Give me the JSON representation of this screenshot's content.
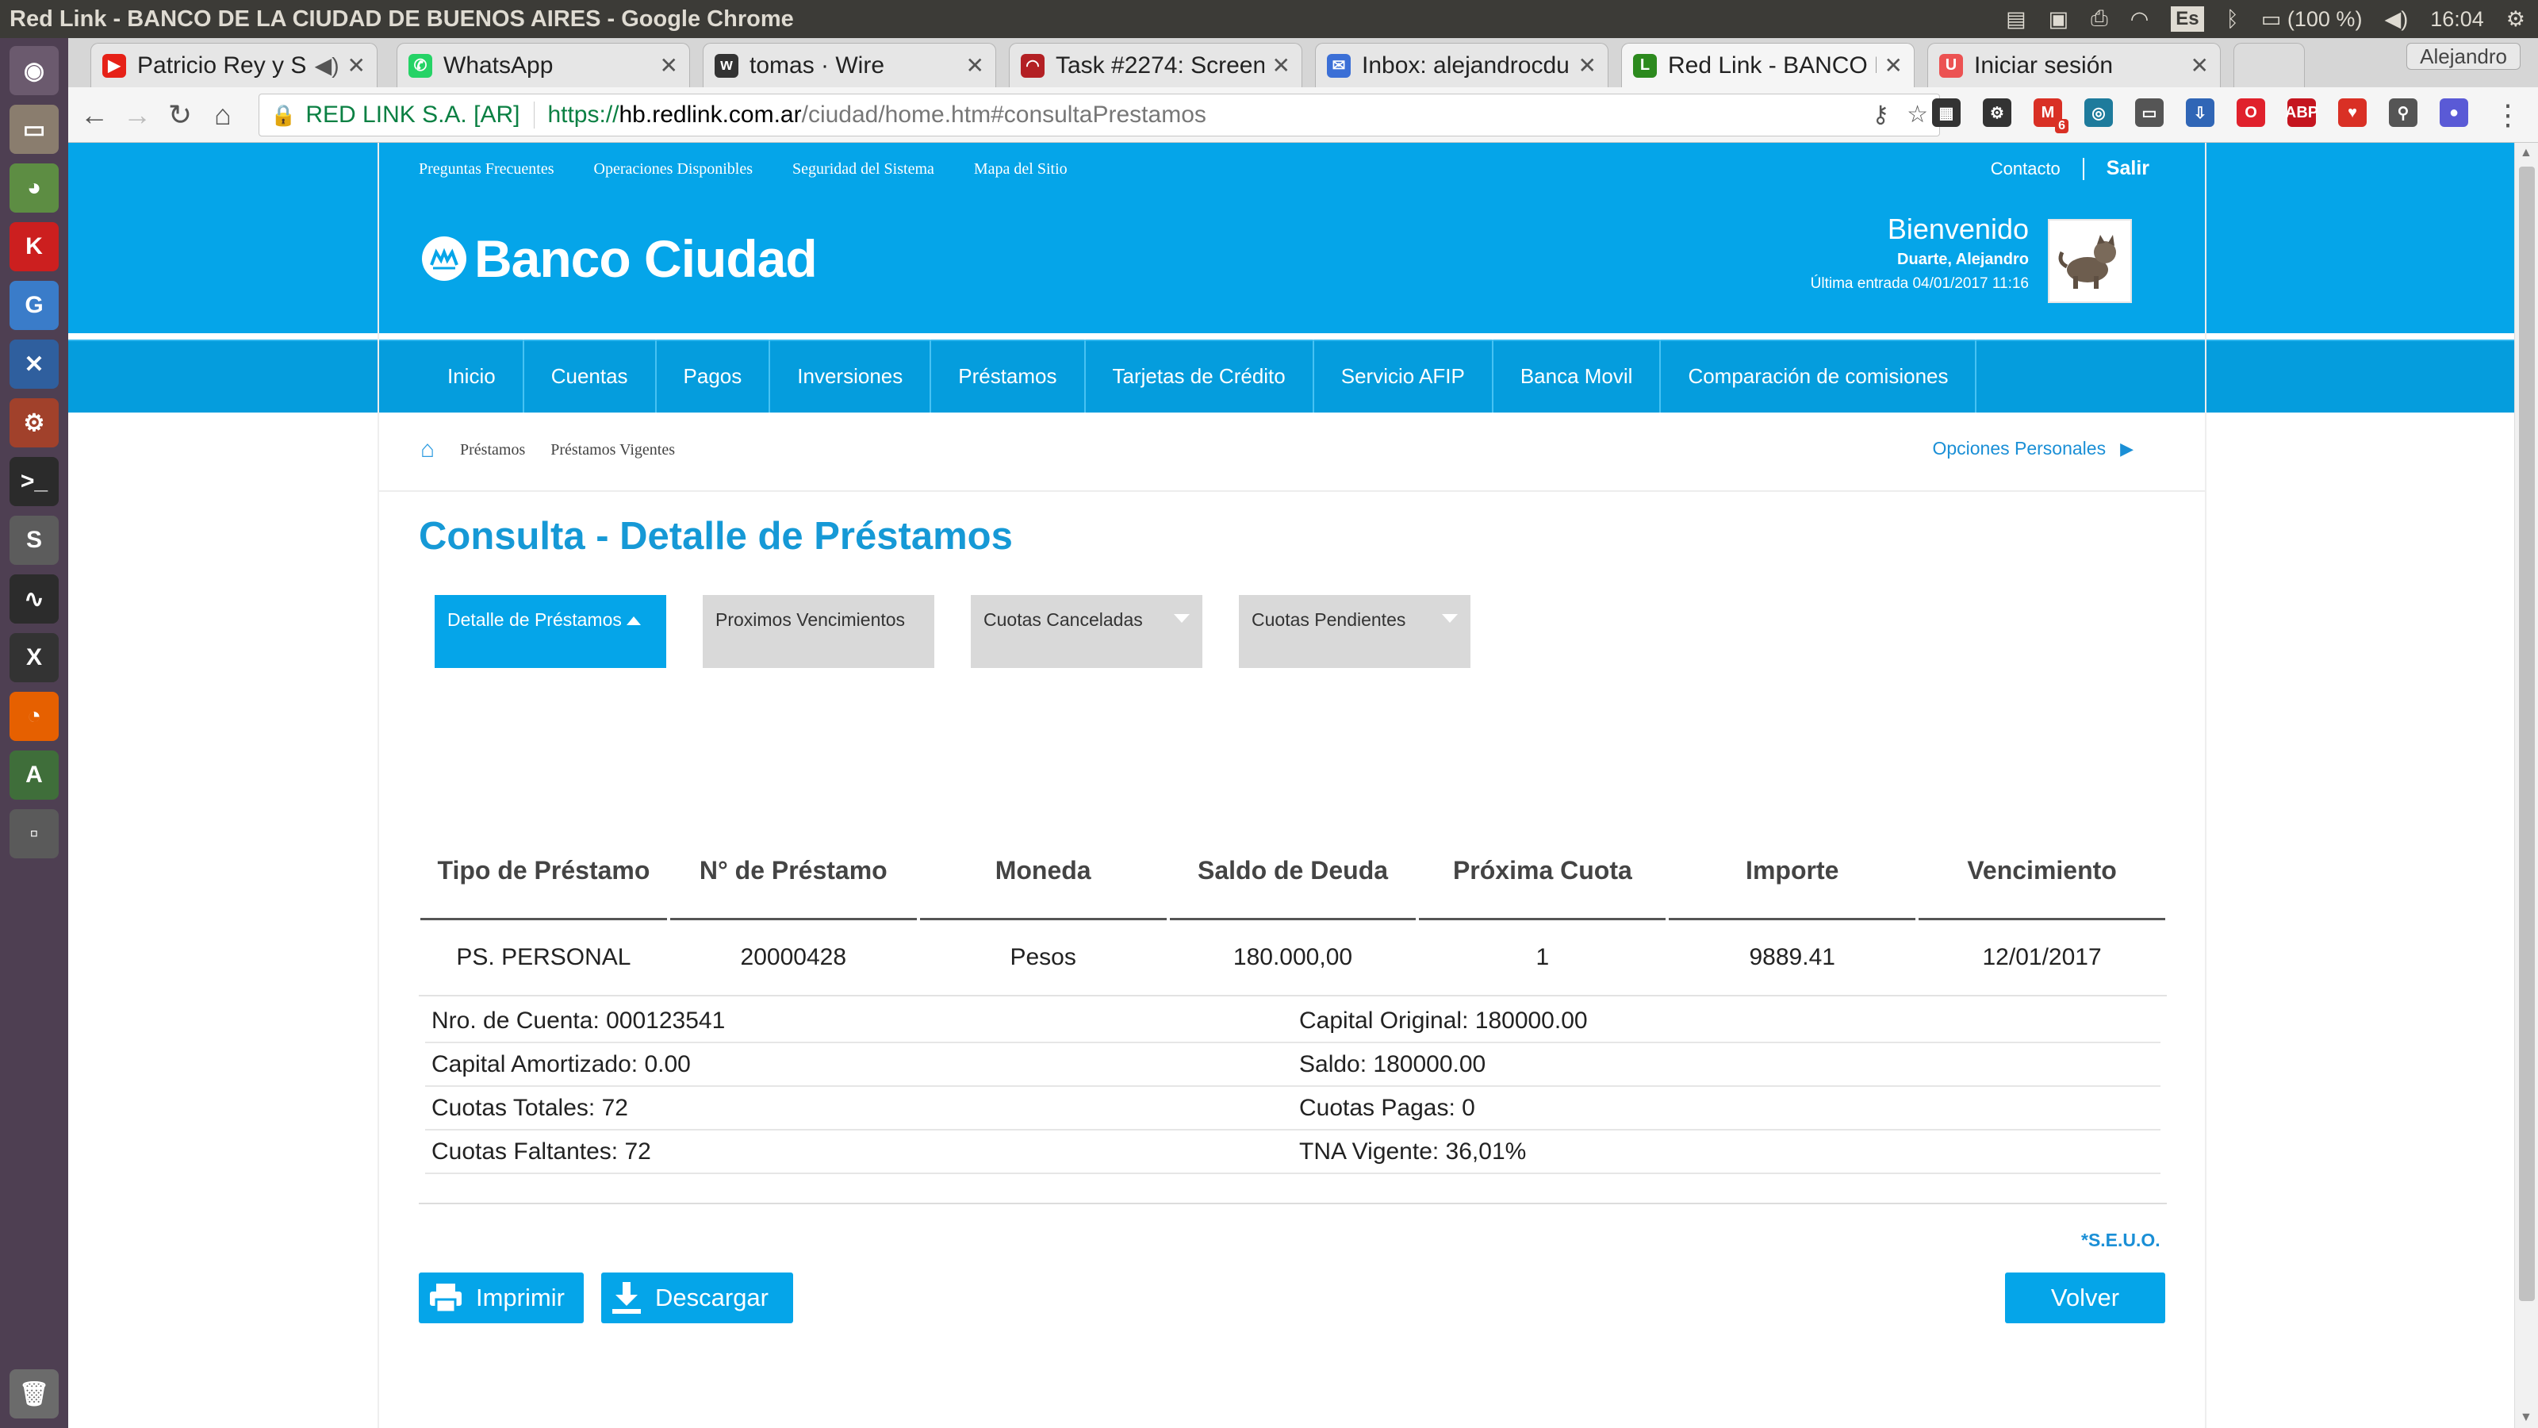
{
  "os": {
    "window_title": "Red Link - BANCO DE LA CIUDAD DE BUENOS AIRES - Google Chrome",
    "keyboard": "Es",
    "battery": "(100 %)",
    "time": "16:04"
  },
  "browser": {
    "tabs": [
      {
        "label": "Patricio Rey y Su",
        "favicon": "youtube-icon",
        "color": "#e62117"
      },
      {
        "label": "WhatsApp",
        "favicon": "whatsapp-icon",
        "color": "#25d366"
      },
      {
        "label": "tomas · Wire",
        "favicon": "wire-icon",
        "color": "#333333"
      },
      {
        "label": "Task #2274: Screen",
        "favicon": "redmine-icon",
        "color": "#b32024"
      },
      {
        "label": "Inbox: alejandrocdu",
        "favicon": "mail-icon",
        "color": "#3b6fd6"
      },
      {
        "label": "Red Link - BANCO D",
        "favicon": "redlink-icon",
        "color": "#2c8a1e"
      },
      {
        "label": "Iniciar sesión",
        "favicon": "udemy-icon",
        "color": "#ec5252"
      }
    ],
    "profile": "Alejandro",
    "address": {
      "secure_label": "RED LINK S.A. [AR]",
      "scheme": "https://",
      "host": "hb.redlink.com.ar",
      "path": "/ciudad/home.htm#consultaPrestamos"
    },
    "extensions": [
      {
        "name": "qr-icon",
        "glyph": "▦",
        "color": "#333333"
      },
      {
        "name": "gear-ext-icon",
        "glyph": "⚙",
        "color": "#333333"
      },
      {
        "name": "gmail-icon",
        "glyph": "M",
        "color": "#d93025",
        "badge": "6"
      },
      {
        "name": "wave-icon",
        "glyph": "◎",
        "color": "#1e7b9c"
      },
      {
        "name": "cast-icon",
        "glyph": "▭",
        "color": "#555555"
      },
      {
        "name": "download-ext-icon",
        "glyph": "⇩",
        "color": "#3066b6"
      },
      {
        "name": "opera-icon",
        "glyph": "O",
        "color": "#e0212c"
      },
      {
        "name": "adblock-icon",
        "glyph": "ABP",
        "color": "#c5151f"
      },
      {
        "name": "shield-ext-icon",
        "glyph": "♥",
        "color": "#d93025"
      },
      {
        "name": "search-ext-icon",
        "glyph": "⚲",
        "color": "#555555"
      },
      {
        "name": "circle-ext-icon",
        "glyph": "●",
        "color": "#5a5ad6"
      }
    ]
  },
  "site": {
    "top_links": [
      "Preguntas Frecuentes",
      "Operaciones Disponibles",
      "Seguridad del Sistema",
      "Mapa del Sitio"
    ],
    "contacto": "Contacto",
    "salir": "Salir",
    "brand": "Banco Ciudad",
    "welcome": "Bienvenido",
    "user_name": "Duarte, Alejandro",
    "last_login": "Última entrada 04/01/2017 11:16",
    "nav": [
      "Inicio",
      "Cuentas",
      "Pagos",
      "Inversiones",
      "Préstamos",
      "Tarjetas de Crédito",
      "Servicio AFIP",
      "Banca Movil",
      "Comparación de comisiones"
    ],
    "breadcrumb": [
      "Préstamos",
      "Préstamos Vigentes"
    ],
    "opciones": "Opciones Personales",
    "title": "Consulta - Detalle de Préstamos",
    "subtabs": [
      "Detalle de Préstamos",
      "Proximos Vencimientos",
      "Cuotas Canceladas",
      "Cuotas Pendientes"
    ],
    "colors": {
      "brand_blue": "#05a5e9",
      "title_blue": "#1699d6"
    }
  },
  "loans": {
    "headers": [
      "Tipo de Préstamo",
      "N° de Préstamo",
      "Moneda",
      "Saldo de Deuda",
      "Próxima Cuota",
      "Importe",
      "Vencimiento"
    ],
    "row": [
      "PS. PERSONAL",
      "20000428",
      "Pesos",
      "180.000,00",
      "1",
      "9889.41",
      "12/01/2017"
    ],
    "details": [
      [
        "Nro. de Cuenta: 000123541",
        "Capital Original: 180000.00"
      ],
      [
        "Capital Amortizado: 0.00",
        "Saldo: 180000.00"
      ],
      [
        "Cuotas Totales: 72",
        "Cuotas Pagas: 0"
      ],
      [
        "Cuotas Faltantes: 72",
        "TNA Vigente: 36,01%"
      ]
    ],
    "seuo": "*S.E.U.O."
  },
  "actions": {
    "print": "Imprimir",
    "download": "Descargar",
    "back": "Volver"
  }
}
